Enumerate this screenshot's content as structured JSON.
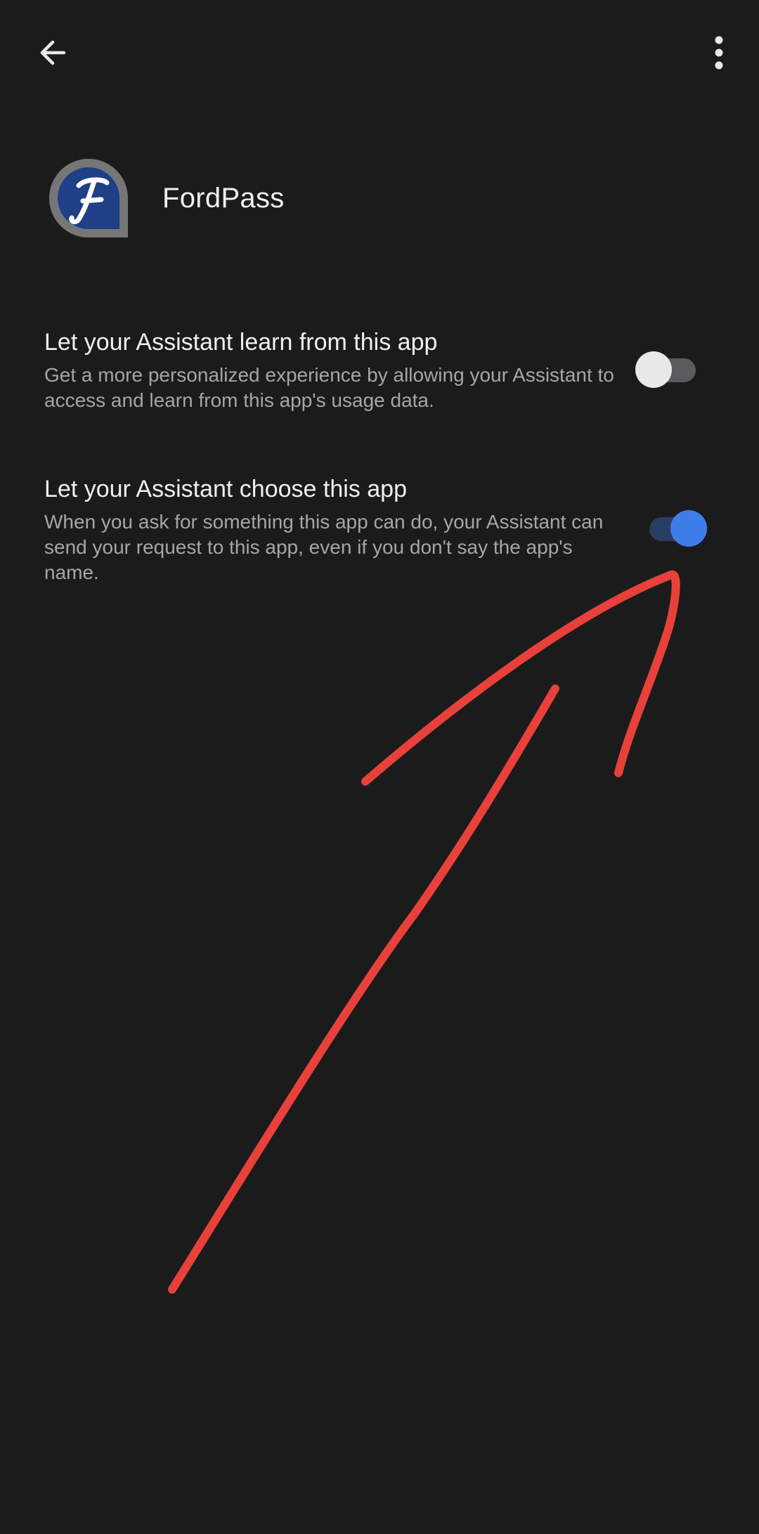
{
  "app": {
    "name": "FordPass",
    "icon": "fordpass-app-icon"
  },
  "topbar": {
    "back_icon": "arrow-back-icon",
    "more_icon": "more-vert-icon"
  },
  "settings": [
    {
      "title": "Let your Assistant learn from this app",
      "description": "Get a more personalized experience by allowing your Assistant to access and learn from this app's usage data.",
      "enabled": false
    },
    {
      "title": "Let your Assistant choose this app",
      "description": "When you ask for something this app can do, your Assistant can send your request to this app, even if you don't say the app's name.",
      "enabled": true
    }
  ],
  "colors": {
    "background": "#1b1b1c",
    "toggle_on": "#3f7ee8",
    "toggle_on_track": "#2a3d63",
    "toggle_off_thumb": "#e9e9e9",
    "toggle_off_track": "#5b5b5d",
    "annotation": "#e8403a"
  }
}
